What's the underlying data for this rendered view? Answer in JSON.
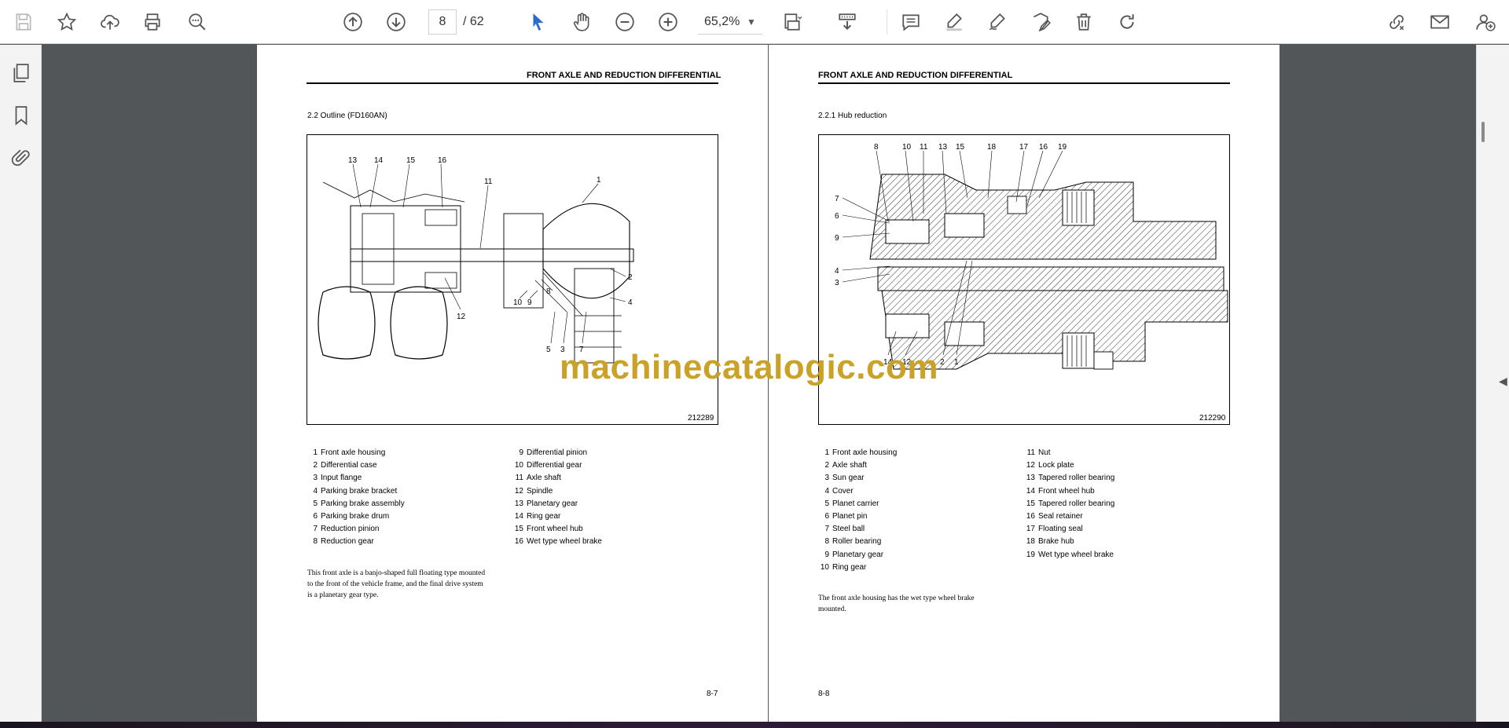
{
  "toolbar": {
    "current_page": "8",
    "page_total": "/ 62",
    "zoom": "65,2%"
  },
  "icons": [
    "save-icon",
    "bookmark-star-icon",
    "upload-cloud-icon",
    "print-icon",
    "zoom-search-icon",
    "page-up-icon",
    "page-down-icon",
    "select-cursor-icon",
    "hand-pan-icon",
    "zoom-out-icon",
    "zoom-in-icon",
    "fit-page-icon",
    "scroll-mode-icon",
    "comment-icon",
    "highlight-icon",
    "draw-icon",
    "edit-text-icon",
    "delete-icon",
    "rotate-icon",
    "share-link-icon",
    "email-icon",
    "add-user-icon",
    "thumbnails-icon",
    "bookmarks-icon",
    "attachments-icon"
  ],
  "left_page": {
    "header": "FRONT AXLE AND REDUCTION DIFFERENTIAL",
    "section": "2.2   Outline (FD160AN)",
    "figure_id": "212289",
    "callouts": [
      "13",
      "14",
      "15",
      "16",
      "11",
      "1",
      "2",
      "4",
      "8",
      "10",
      "9",
      "12",
      "5",
      "3",
      "7"
    ],
    "legend_left": [
      {
        "num": "1",
        "label": "Front axle housing"
      },
      {
        "num": "2",
        "label": "Differential case"
      },
      {
        "num": "3",
        "label": "Input flange"
      },
      {
        "num": "4",
        "label": "Parking brake bracket"
      },
      {
        "num": "5",
        "label": "Parking brake assembly"
      },
      {
        "num": "6",
        "label": "Parking brake drum"
      },
      {
        "num": "7",
        "label": "Reduction pinion"
      },
      {
        "num": "8",
        "label": "Reduction gear"
      }
    ],
    "legend_right": [
      {
        "num": "9",
        "label": "Differential pinion"
      },
      {
        "num": "10",
        "label": "Differential gear"
      },
      {
        "num": "11",
        "label": "Axle shaft"
      },
      {
        "num": "12",
        "label": "Spindle"
      },
      {
        "num": "13",
        "label": "Planetary gear"
      },
      {
        "num": "14",
        "label": "Ring gear"
      },
      {
        "num": "15",
        "label": "Front wheel hub"
      },
      {
        "num": "16",
        "label": "Wet type wheel brake"
      }
    ],
    "body": [
      "This front axle is a banjo-shaped full floating type mounted",
      "to the front of the vehicle frame, and the final drive system",
      "is a planetary gear type."
    ],
    "page_number": "8-7"
  },
  "right_page": {
    "header": "FRONT AXLE AND REDUCTION DIFFERENTIAL",
    "section": "2.2.1   Hub reduction",
    "figure_id": "212290",
    "callouts": [
      "8",
      "10",
      "11",
      "13",
      "15",
      "18",
      "17",
      "16",
      "19",
      "7",
      "6",
      "9",
      "4",
      "3",
      "14",
      "12",
      "2",
      "1"
    ],
    "legend_left": [
      {
        "num": "1",
        "label": "Front axle housing"
      },
      {
        "num": "2",
        "label": "Axle shaft"
      },
      {
        "num": "3",
        "label": "Sun gear"
      },
      {
        "num": "4",
        "label": "Cover"
      },
      {
        "num": "5",
        "label": "Planet carrier"
      },
      {
        "num": "6",
        "label": "Planet pin"
      },
      {
        "num": "7",
        "label": "Steel ball"
      },
      {
        "num": "8",
        "label": "Roller bearing"
      },
      {
        "num": "9",
        "label": "Planetary gear"
      },
      {
        "num": "10",
        "label": "Ring gear"
      }
    ],
    "legend_right": [
      {
        "num": "11",
        "label": "Nut"
      },
      {
        "num": "12",
        "label": "Lock plate"
      },
      {
        "num": "13",
        "label": "Tapered roller bearing"
      },
      {
        "num": "14",
        "label": "Front wheel hub"
      },
      {
        "num": "15",
        "label": "Tapered roller bearing"
      },
      {
        "num": "16",
        "label": "Seal retainer"
      },
      {
        "num": "17",
        "label": "Floating seal"
      },
      {
        "num": "18",
        "label": "Brake hub"
      },
      {
        "num": "19",
        "label": "Wet type wheel brake"
      }
    ],
    "body": [
      "The front axle housing has the wet type wheel brake",
      "mounted."
    ],
    "page_number": "8-8"
  },
  "watermark": "machinecatalogic.com"
}
